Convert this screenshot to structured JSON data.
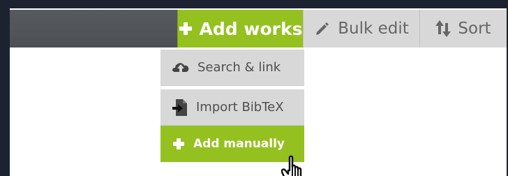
{
  "toolbar": {
    "add_label": "Add works",
    "bulk_label": "Bulk edit",
    "sort_label": "Sort"
  },
  "dropdown": {
    "items": [
      {
        "label": "Search & link",
        "icon": "cloud-upload-icon"
      },
      {
        "label": "Import BibTeX",
        "icon": "import-file-icon"
      },
      {
        "label": "Add manually",
        "icon": "plus-icon"
      }
    ]
  },
  "cursor": {
    "icon": "hand-pointer-icon"
  },
  "colors": {
    "accent": "#94c11f",
    "toolbar_dark": "#55595e",
    "button_gray": "#d8d8d8",
    "frame_dark": "#1d2230"
  }
}
